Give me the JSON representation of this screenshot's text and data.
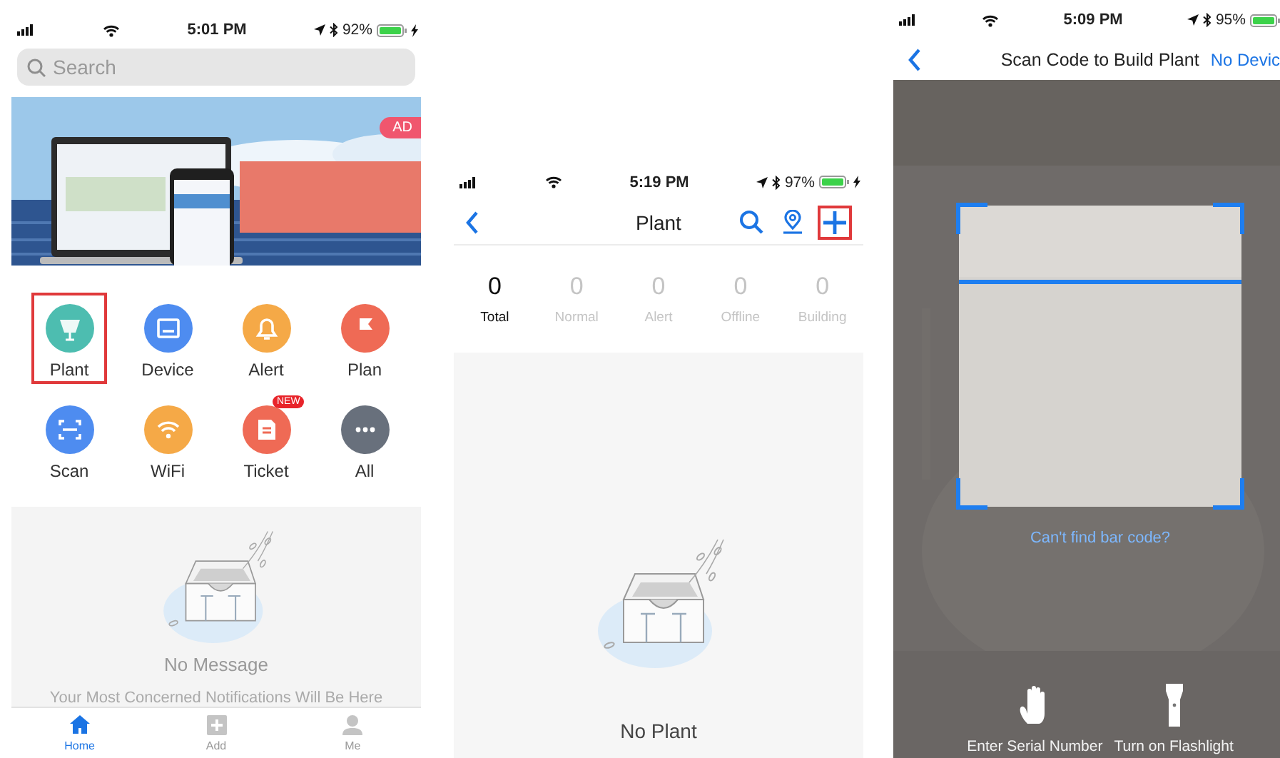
{
  "home_screen": {
    "status_bar": {
      "time": "5:01 PM",
      "battery": "92%",
      "charging": true
    },
    "search": {
      "placeholder": "Search"
    },
    "banner": {
      "badge": "AD"
    },
    "shortcuts": [
      {
        "label": "Plant",
        "color": "#4dbdb0",
        "highlighted": true
      },
      {
        "label": "Device",
        "color": "#4e8cf0",
        "highlighted": false
      },
      {
        "label": "Alert",
        "color": "#f5a947",
        "highlighted": false
      },
      {
        "label": "Plan",
        "color": "#ef6a55",
        "highlighted": false
      },
      {
        "label": "Scan",
        "color": "#4e8cf0",
        "highlighted": false
      },
      {
        "label": "WiFi",
        "color": "#f5a947",
        "highlighted": false
      },
      {
        "label": "Ticket",
        "color": "#ef6a55",
        "highlighted": false,
        "badge": "NEW"
      },
      {
        "label": "All",
        "color": "#68707c",
        "highlighted": false
      }
    ],
    "empty_state": {
      "title": "No Message",
      "subtitle": "Your Most Concerned Notifications Will Be Here"
    },
    "tab_bar": [
      {
        "label": "Home",
        "selected": true
      },
      {
        "label": "Add",
        "selected": false
      },
      {
        "label": "Me",
        "selected": false
      }
    ]
  },
  "plant_screen": {
    "status_bar": {
      "time": "5:19 PM",
      "battery": "97%",
      "charging": true
    },
    "title": "Plant",
    "add_highlighted": true,
    "stats": [
      {
        "value": "0",
        "label": "Total",
        "selected": true
      },
      {
        "value": "0",
        "label": "Normal",
        "selected": false
      },
      {
        "value": "0",
        "label": "Alert",
        "selected": false
      },
      {
        "value": "0",
        "label": "Offline",
        "selected": false
      },
      {
        "value": "0",
        "label": "Building",
        "selected": false
      }
    ],
    "empty_state": {
      "title": "No Plant"
    }
  },
  "scan_screen": {
    "status_bar": {
      "time": "5:09 PM",
      "battery": "95%"
    },
    "title": "Scan Code to Build Plant",
    "action": "No Devic",
    "hint": "Can't find bar code?",
    "actions": [
      {
        "label": "Enter Serial Number"
      },
      {
        "label": "Turn on Flashlight"
      }
    ]
  }
}
